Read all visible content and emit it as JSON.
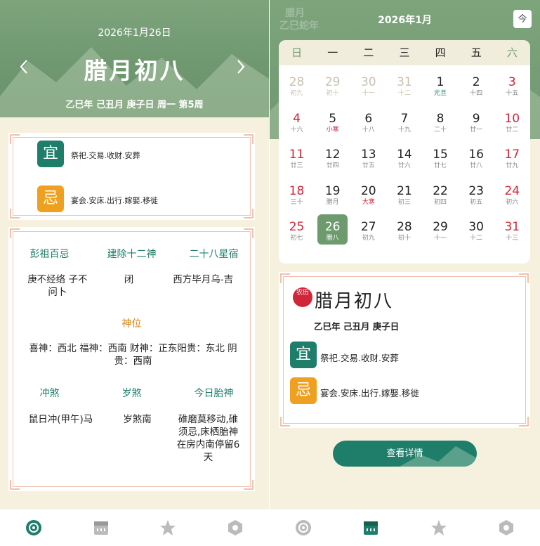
{
  "left": {
    "date": "2026年1月26日",
    "lunar_title": "腊月初八",
    "ganzhi": "乙巳年 己丑月 庚子日 周一 第5周",
    "yi_label": "宜",
    "yi_text": "祭祀.交易.收财.安葬",
    "ji_label": "忌",
    "ji_text": "宴会.安床.出行.嫁娶.移徙",
    "sections": {
      "pengzu_title": "彭祖百忌",
      "pengzu_value": "庚不经络 子不问卜",
      "jianchu_title": "建除十二神",
      "jianchu_value": "闭",
      "xiu_title": "二十八星宿",
      "xiu_value": "西方毕月乌-吉",
      "shenwei_title": "神位",
      "shenwei_value": "喜神：西北 福神：西南 财神：正东阳贵：东北 阴贵：西南",
      "chongsha_title": "冲煞",
      "chongsha_value": "鼠日冲(甲午)马",
      "suisha_title": "岁煞",
      "suisha_value": "岁煞南",
      "taishen_title": "今日胎神",
      "taishen_value": "碓磨莫移动,碓须忌,床栖胎神在房内南停留6天"
    }
  },
  "right": {
    "title": "2026年1月",
    "ghost_line1": "腊月",
    "ghost_line2": "乙巳蛇年",
    "today_label": "今",
    "weekdays": [
      "日",
      "一",
      "二",
      "三",
      "四",
      "五",
      "六"
    ],
    "days": [
      {
        "n": "28",
        "l": "初九",
        "t": "out"
      },
      {
        "n": "29",
        "l": "初十",
        "t": "out"
      },
      {
        "n": "30",
        "l": "十一",
        "t": "out"
      },
      {
        "n": "31",
        "l": "十二",
        "t": "out"
      },
      {
        "n": "1",
        "l": "元旦",
        "t": "fest"
      },
      {
        "n": "2",
        "l": "十四",
        "t": ""
      },
      {
        "n": "3",
        "l": "十五",
        "t": "red"
      },
      {
        "n": "4",
        "l": "十六",
        "t": "red"
      },
      {
        "n": "5",
        "l": "小寒",
        "t": "term"
      },
      {
        "n": "6",
        "l": "十八",
        "t": ""
      },
      {
        "n": "7",
        "l": "十九",
        "t": ""
      },
      {
        "n": "8",
        "l": "二十",
        "t": ""
      },
      {
        "n": "9",
        "l": "廿一",
        "t": ""
      },
      {
        "n": "10",
        "l": "廿二",
        "t": "red"
      },
      {
        "n": "11",
        "l": "廿三",
        "t": "red"
      },
      {
        "n": "12",
        "l": "廿四",
        "t": ""
      },
      {
        "n": "13",
        "l": "廿五",
        "t": ""
      },
      {
        "n": "14",
        "l": "廿六",
        "t": ""
      },
      {
        "n": "15",
        "l": "廿七",
        "t": ""
      },
      {
        "n": "16",
        "l": "廿八",
        "t": ""
      },
      {
        "n": "17",
        "l": "廿九",
        "t": "red"
      },
      {
        "n": "18",
        "l": "三十",
        "t": "red"
      },
      {
        "n": "19",
        "l": "腊月",
        "t": ""
      },
      {
        "n": "20",
        "l": "大寒",
        "t": "term"
      },
      {
        "n": "21",
        "l": "初三",
        "t": ""
      },
      {
        "n": "22",
        "l": "初四",
        "t": ""
      },
      {
        "n": "23",
        "l": "初五",
        "t": ""
      },
      {
        "n": "24",
        "l": "初六",
        "t": "red"
      },
      {
        "n": "25",
        "l": "初七",
        "t": "red"
      },
      {
        "n": "26",
        "l": "腊八",
        "t": "sel"
      },
      {
        "n": "27",
        "l": "初九",
        "t": ""
      },
      {
        "n": "28",
        "l": "初十",
        "t": ""
      },
      {
        "n": "29",
        "l": "十一",
        "t": ""
      },
      {
        "n": "30",
        "l": "十二",
        "t": ""
      },
      {
        "n": "31",
        "l": "十三",
        "t": "red"
      }
    ],
    "nongli_badge": "农历",
    "lunar_title": "腊月初八",
    "ganzhi": "乙巳年 己丑月 庚子日",
    "yi_label": "宜",
    "yi_text": "祭祀.交易.收财.安葬",
    "ji_label": "忌",
    "ji_text": "宴会.安床.出行.嫁娶.移徙",
    "detail_button": "查看详情"
  },
  "nav_icons": [
    "almanac-icon",
    "calendar-icon",
    "star-icon",
    "hexagon-icon"
  ],
  "colors": {
    "header_green": "#6f9870",
    "accent_teal": "#1e7e6a",
    "ji_orange": "#f0a020",
    "holiday_red": "#d0263a",
    "background_cream": "#f6f1df",
    "border_peach": "#f0c2ae"
  }
}
